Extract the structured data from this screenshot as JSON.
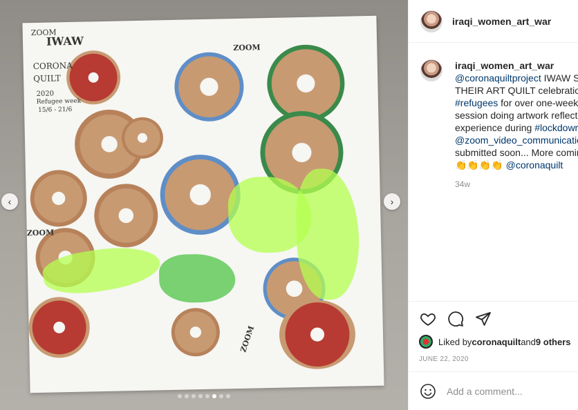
{
  "post": {
    "username": "iraqi_women_art_war",
    "image_alt": "Art quilt with pencil shavings and Arabic calligraphy"
  },
  "photo_doodles": {
    "zoom_1": "ZOOM",
    "iwaw": "IWAW",
    "corona": "CORONA",
    "quilt": "QUILT",
    "year": "2020",
    "refugee": "Refugee week",
    "dates": "15/6 - 21/6",
    "zoom_2": "ZOOM",
    "zoom_3": "ZOOM",
    "zoom_4": "ZOOM"
  },
  "carousel": {
    "prev_icon": "chevron-left-icon",
    "next_icon": "chevron-right-icon",
    "dot_count": 8,
    "active_index": 5
  },
  "caption": {
    "username": "iraqi_women_art_war",
    "lines": [
      {
        "pre": "",
        "link": "",
        "post": " IWAW S"
      },
      {
        "pre": "",
        "link": "@coronaquiltproject",
        "post": " IWAW S"
      },
      {
        "pre": "THEIR ART QUILT celebration",
        "link": "",
        "post": ""
      },
      {
        "pre": "",
        "link": "#refugees",
        "post": " for over one-week"
      },
      {
        "pre": "session doing artwork reflecti",
        "link": "",
        "post": ""
      },
      {
        "pre": "experience during ",
        "link": "#lockdowr",
        "post": ""
      },
      {
        "pre": "",
        "link": "@zoom_video_communicatio",
        "post": ""
      },
      {
        "pre": "submitted soon... More comin",
        "link": "",
        "post": ""
      },
      {
        "pre": "👏👏👏👏 ",
        "link": "@coronaquilt",
        "post": ""
      }
    ],
    "time_ago": "34w"
  },
  "actions": {
    "like_icon": "heart-icon",
    "comment_icon": "comment-icon",
    "share_icon": "share-icon",
    "liked_prefix": "Liked by ",
    "liked_user": "coronaquilt",
    "liked_middle": " and ",
    "liked_others": "9 others",
    "date": "JUNE 22, 2020"
  },
  "comment": {
    "emoji_icon": "smiley-icon",
    "placeholder": "Add a comment..."
  }
}
